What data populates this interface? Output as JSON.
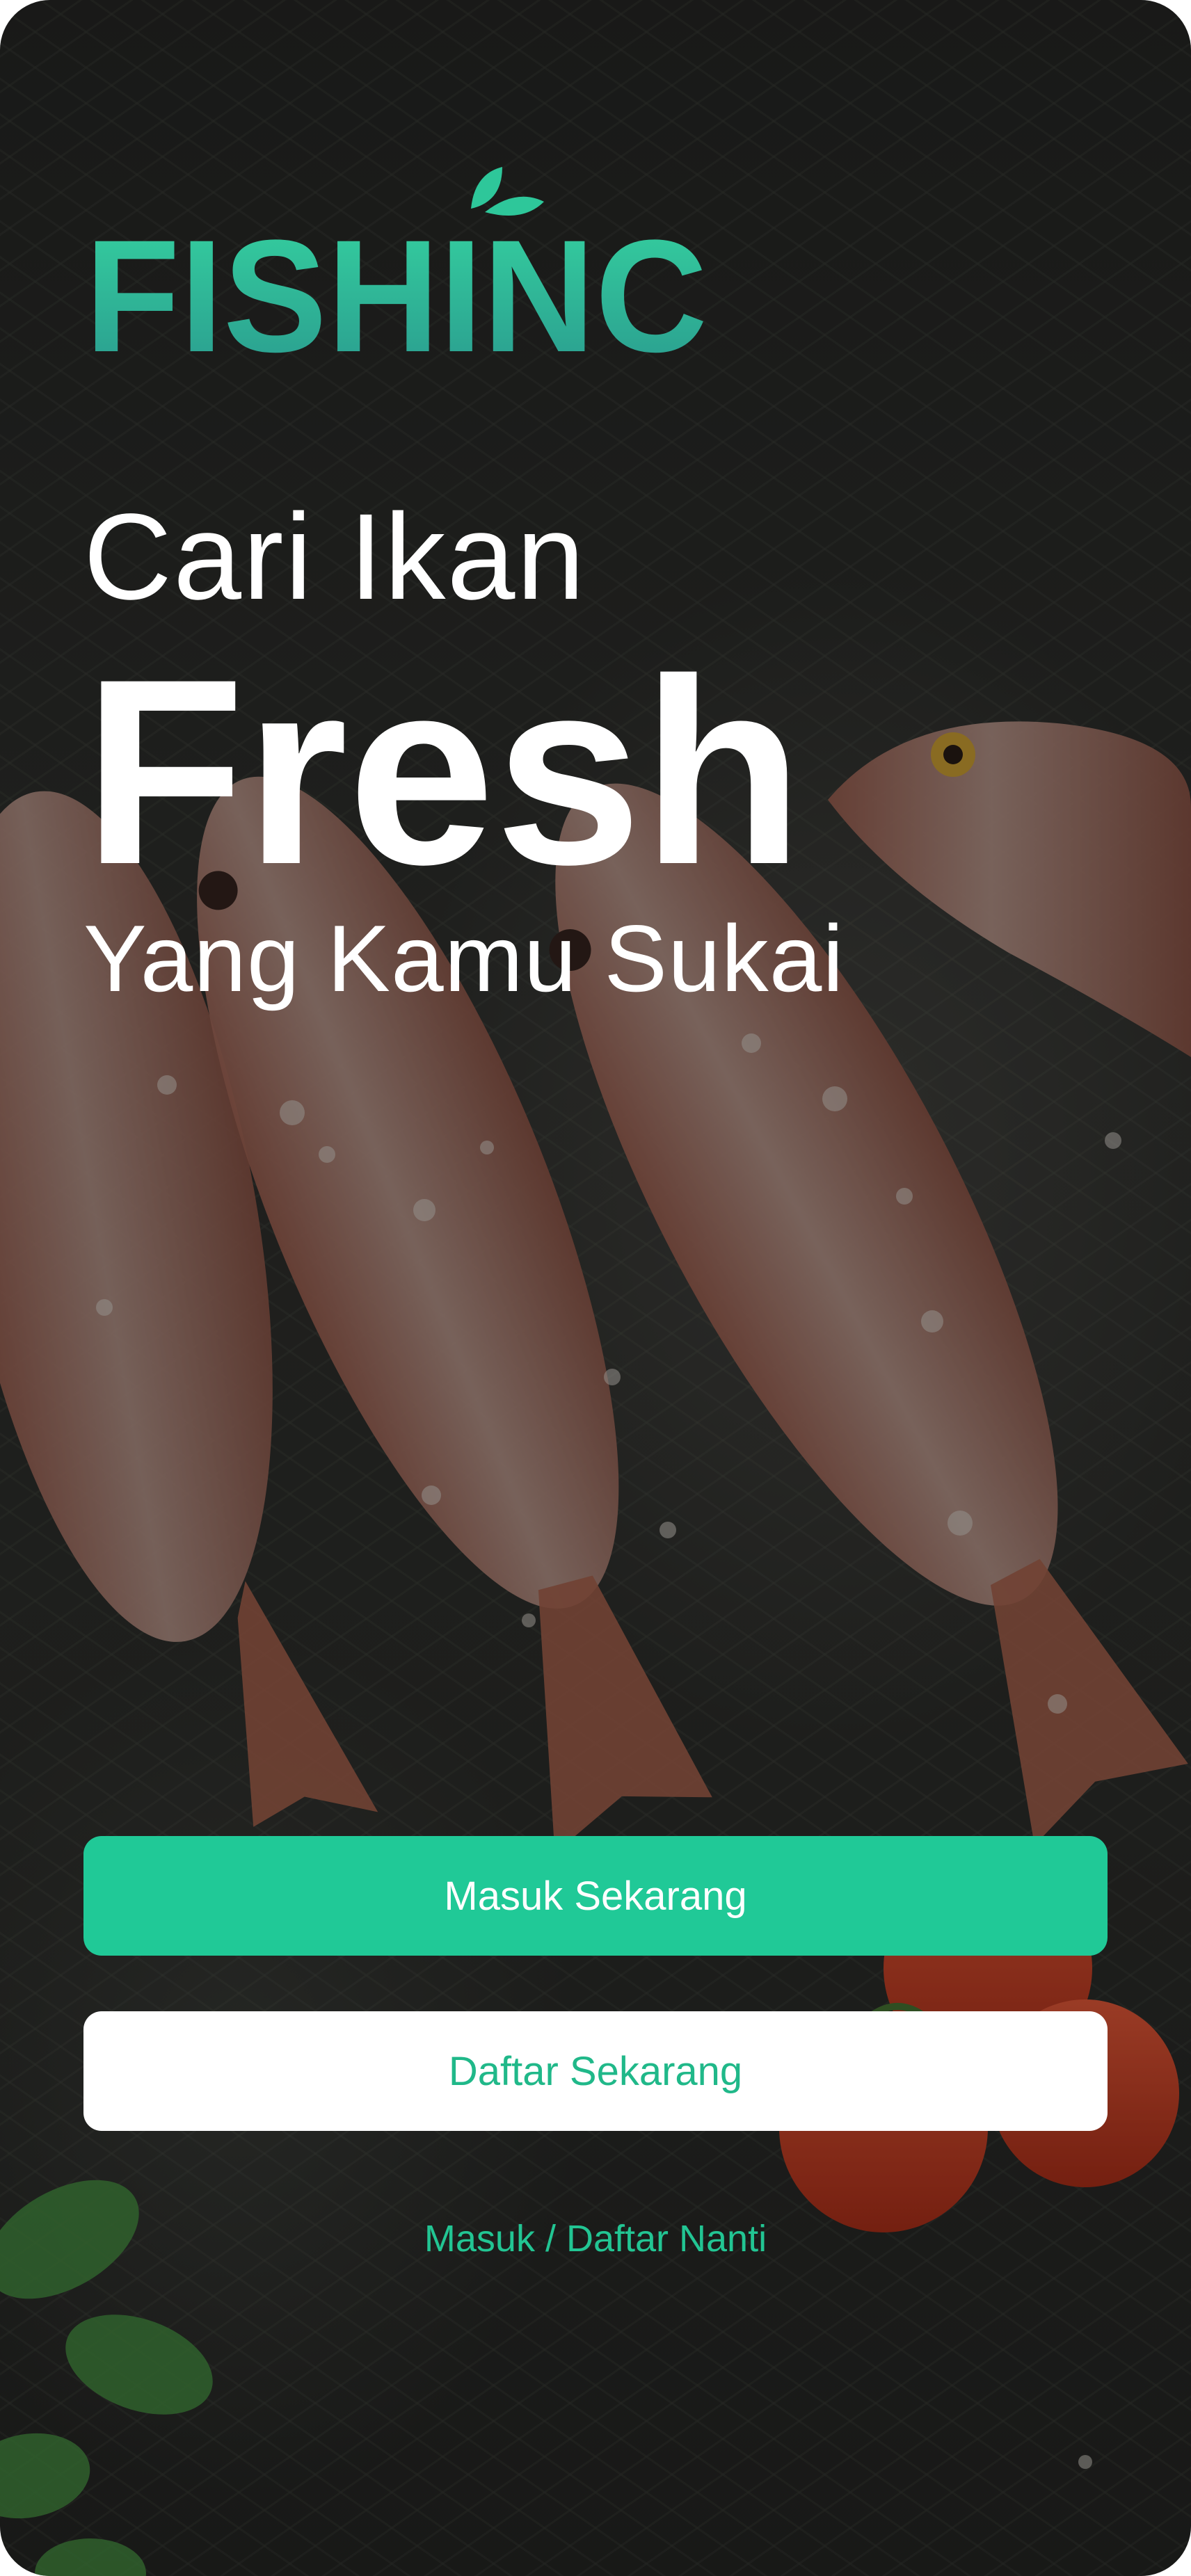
{
  "brand": {
    "logo_text": "FISHINC",
    "logo_gradient_top": "#35d2a0",
    "logo_gradient_bottom": "#2aa08e",
    "leaf_color": "#2ec79a"
  },
  "hero": {
    "line1": "Cari Ikan",
    "line2": "Fresh",
    "line3": "Yang Kamu Sukai"
  },
  "actions": {
    "login_label": "Masuk Sekarang",
    "register_label": "Daftar Sekarang",
    "skip_label": "Masuk / Daftar Nanti"
  },
  "colors": {
    "accent": "#20c997",
    "background_dark": "#1f201e",
    "button_text_light": "#ffffff"
  }
}
